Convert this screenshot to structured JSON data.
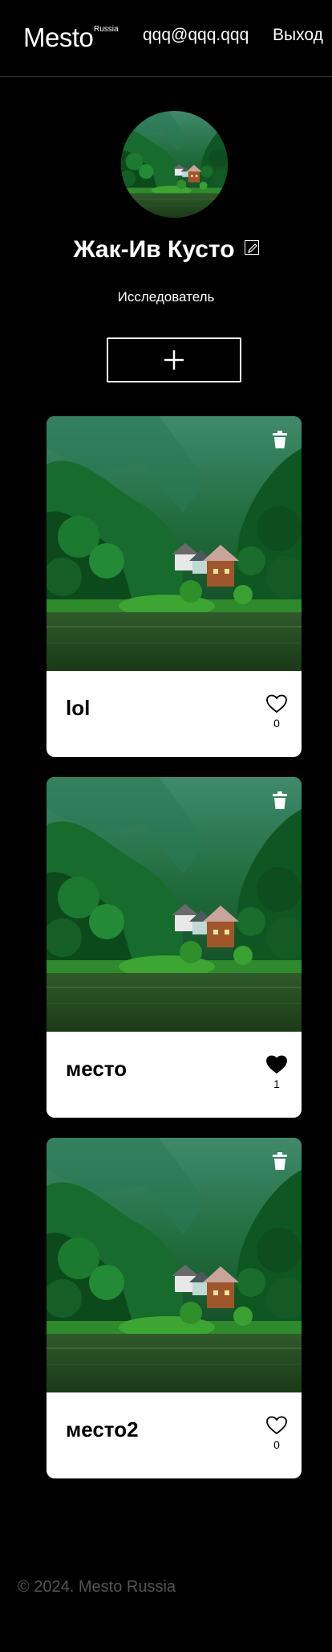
{
  "header": {
    "logo": "Mesto",
    "logo_sub": "Russia",
    "email": "qqq@qqq.qqq",
    "logout": "Выход"
  },
  "profile": {
    "name": "Жак-Ив Кусто",
    "about": "Исследователь",
    "edit_icon": "pencil-icon",
    "add_icon": "plus-icon"
  },
  "cards": [
    {
      "title": "lol",
      "likes": "0",
      "liked": false
    },
    {
      "title": "место",
      "likes": "1",
      "liked": true
    },
    {
      "title": "место2",
      "likes": "0",
      "liked": false
    }
  ],
  "footer": {
    "copyright": "© 2024. Mesto Russia"
  },
  "colors": {
    "background": "#000000",
    "card": "#ffffff",
    "footer_text": "#545454"
  }
}
